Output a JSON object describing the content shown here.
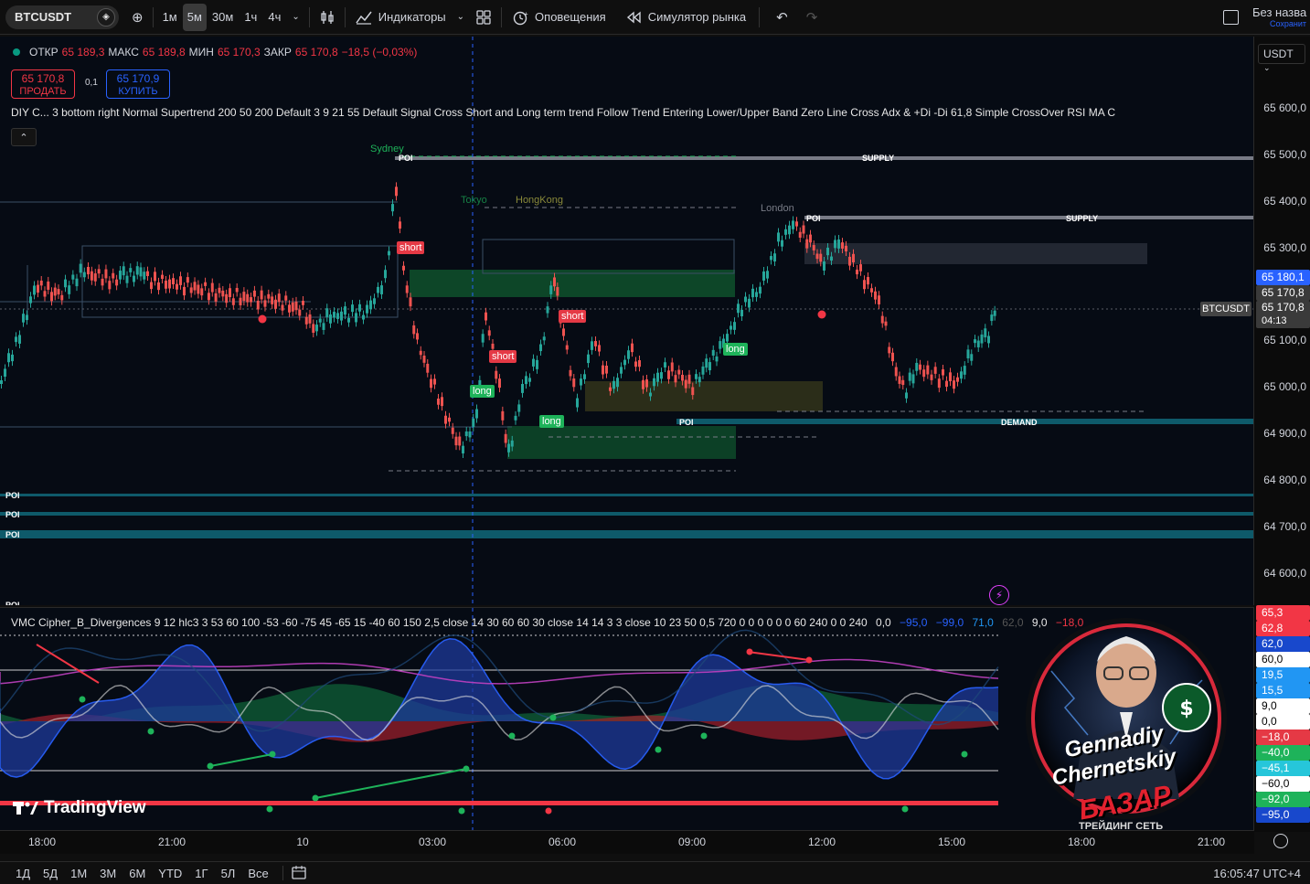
{
  "toolbar": {
    "symbol": "BTCUSDT",
    "timeframes": [
      "1м",
      "5м",
      "30м",
      "1ч",
      "4ч"
    ],
    "active_timeframe": "5м",
    "indicators_label": "Индикаторы",
    "alerts_label": "Оповещения",
    "replay_label": "Симулятор рынка",
    "layout_name": "Без назва",
    "layout_saved": "Сохранит"
  },
  "legend": {
    "open_label": "ОТКР",
    "open": "65 189,3",
    "high_label": "МАКС",
    "high": "65 189,8",
    "low_label": "МИН",
    "low": "65 170,3",
    "close_label": "ЗАКР",
    "close": "65 170,8",
    "change": "−18,5 (−0,03%)",
    "sell_price": "65 170,8",
    "sell_label": "ПРОДАТЬ",
    "spread": "0,1",
    "buy_price": "65 170,9",
    "buy_label": "КУПИТЬ",
    "indicator_text": "DIY C...  3 bottom right Normal Supertrend 200 50 200 Default 3 9 21 55 Default Signal Cross Short and Long term trend Follow Trend Entering Lower/Upper Band Zero Line Cross Adx & +Di -Di 61,8 Simple CrossOver RSI MA C"
  },
  "currency": "USDT",
  "price_axis": {
    "labels": [
      "65 600,0",
      "65 500,0",
      "65 400,0",
      "65 300,0",
      "65 100,0",
      "65 000,0",
      "64 900,0",
      "64 800,0",
      "64 700,0",
      "64 600,0"
    ],
    "tag_high": "65 180,1",
    "tag_close": "65 170,8",
    "tag_last": "65 170,8",
    "tag_countdown": "04:13",
    "symbol_tag": "BTCUSDT"
  },
  "time_axis": {
    "labels": [
      "18:00",
      "21:00",
      "10",
      "03:00",
      "06:00",
      "09:00",
      "12:00",
      "15:00",
      "18:00",
      "21:00"
    ]
  },
  "chart_labels": {
    "sessions": [
      "Sydney",
      "Tokyo",
      "HongKong",
      "London"
    ],
    "poi": "POI",
    "supply": "SUPPLY",
    "demand": "DEMAND",
    "short": "short",
    "long": "long"
  },
  "oscillator": {
    "legend": "VMC Cipher_B_Divergences 9 12 hlc3 3 53 60 100 -53 -60 -75 45 -65 15 -40 60 150 2,5 close 14 30 60 60 30 close 14 14 3 3 close 10 23 50 0,5 720 0 0 0 0 0 0 60 240 0 0 240",
    "legend_values": [
      "0,0",
      "−95,0",
      "−99,0",
      "71,0",
      "62,0",
      "9,0",
      "−18,0"
    ],
    "axis_badges": [
      {
        "text": "65,3",
        "color": "#f23645"
      },
      {
        "text": "62,8",
        "color": "#f23645"
      },
      {
        "text": "62,0",
        "color": "#1848cc"
      },
      {
        "text": "60,0",
        "color": "#ffffff"
      },
      {
        "text": "19,5",
        "color": "#2196f3"
      },
      {
        "text": "15,5",
        "color": "#2196f3"
      },
      {
        "text": "9,0",
        "color": "#ffffff"
      },
      {
        "text": "0,0",
        "color": "#ffffff"
      },
      {
        "text": "−18,0",
        "color": "#e53945"
      },
      {
        "text": "−40,0",
        "color": "#1eb35a"
      },
      {
        "text": "−45,1",
        "color": "#26c6da"
      },
      {
        "text": "−60,0",
        "color": "#ffffff"
      },
      {
        "text": "−92,0",
        "color": "#1eb35a"
      },
      {
        "text": "−95,0",
        "color": "#1848cc"
      }
    ]
  },
  "watermark": {
    "brand": "TradingView",
    "avatar_name_1": "Gennadiy",
    "avatar_name_2": "Chernetskiy",
    "avatar_brand": "БАЗАР",
    "avatar_sub": "ТРЕЙДИНГ СЕТЬ"
  },
  "bottombar": {
    "ranges": [
      "1Д",
      "5Д",
      "1М",
      "3М",
      "6М",
      "YTD",
      "1Г",
      "5Л",
      "Все"
    ],
    "clock": "16:05:47 UTC+4"
  }
}
